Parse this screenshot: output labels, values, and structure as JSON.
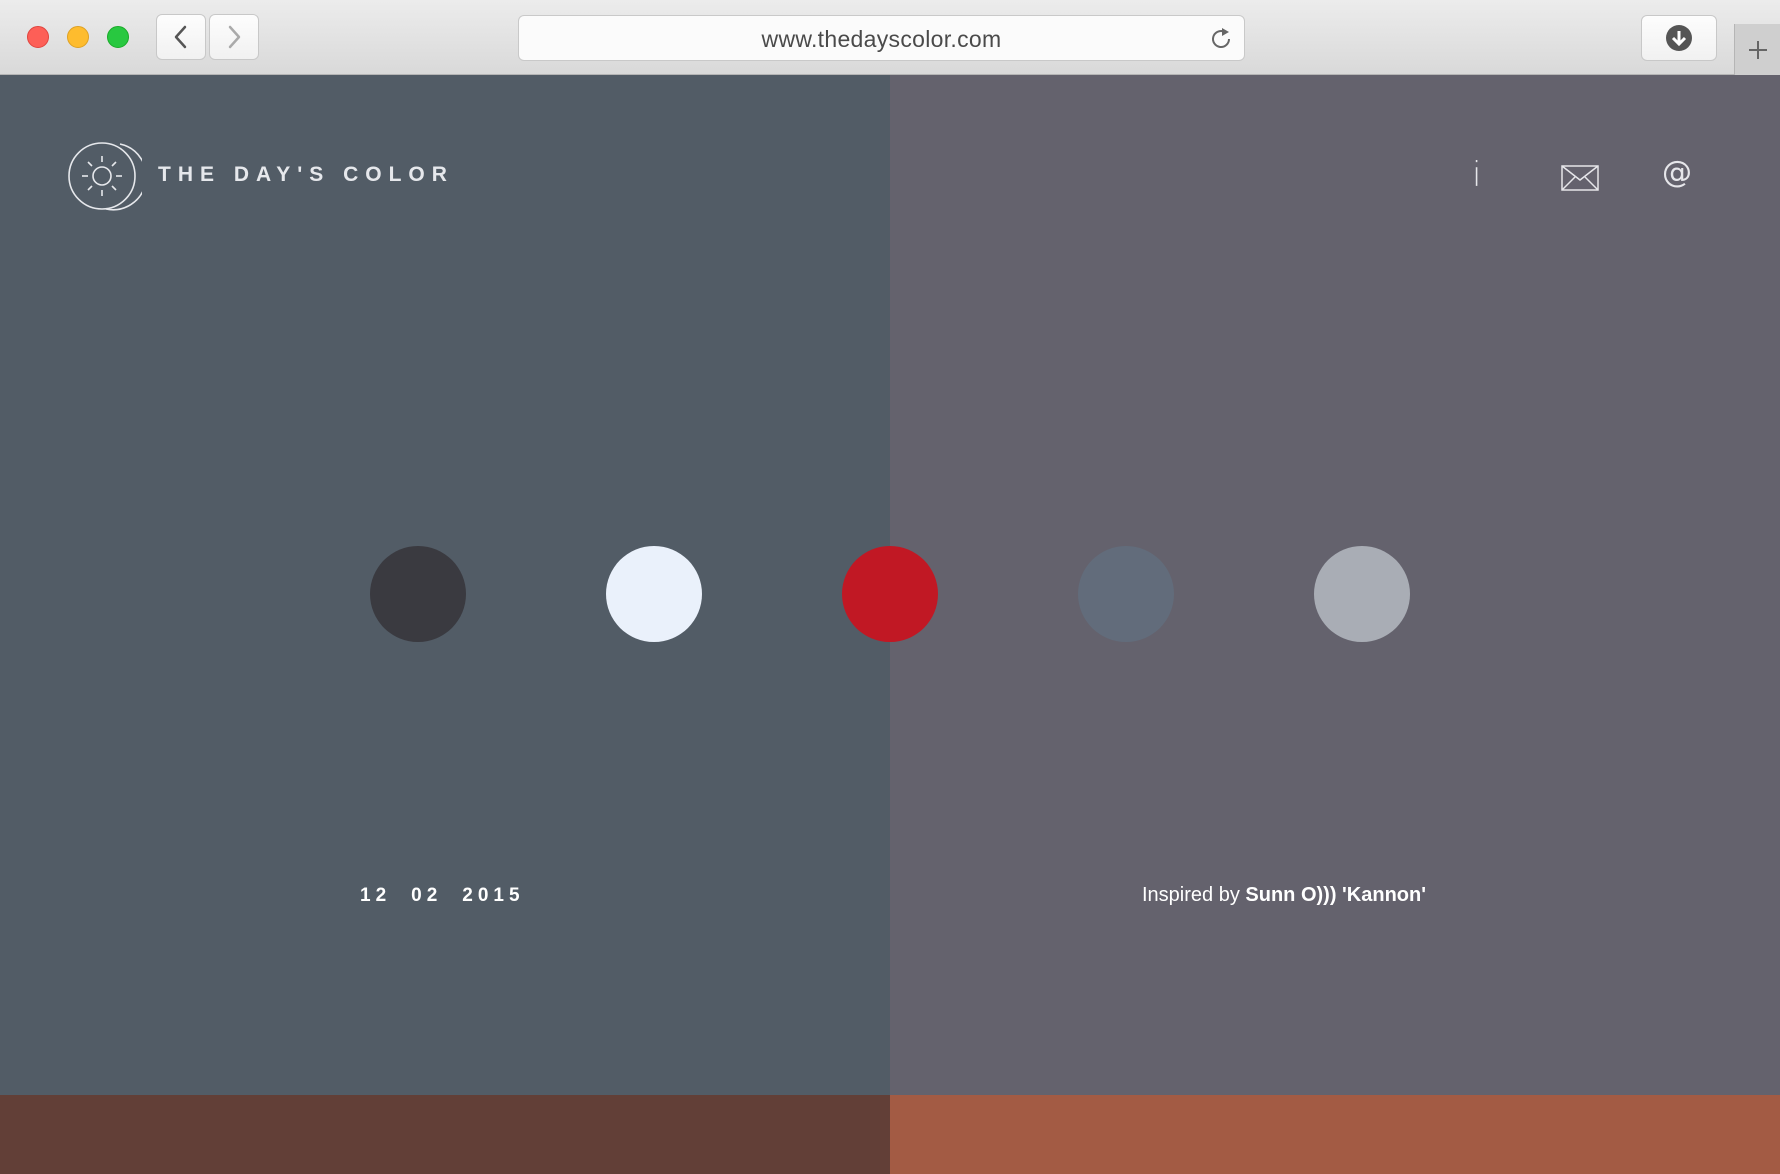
{
  "browser": {
    "url": "www.thedayscolor.com"
  },
  "header": {
    "brand": "THE DAY'S COLOR",
    "nav": {
      "info_label": "i",
      "at_label": "@"
    }
  },
  "panels": {
    "left_color": "#525c66",
    "right_color": "#64626d",
    "bottom_left_color": "#623f37",
    "bottom_right_color": "#a35b44"
  },
  "palette": {
    "swatches": [
      {
        "color": "#3a3a40"
      },
      {
        "color": "#eaf1fb"
      },
      {
        "color": "#c11824"
      },
      {
        "color": "#626c7b"
      },
      {
        "color": "#a9adb5"
      }
    ]
  },
  "date": {
    "day": "12",
    "month": "02",
    "year": "2015"
  },
  "inspiration": {
    "prefix": "Inspired by ",
    "title": "Sunn O))) 'Kannon'"
  }
}
